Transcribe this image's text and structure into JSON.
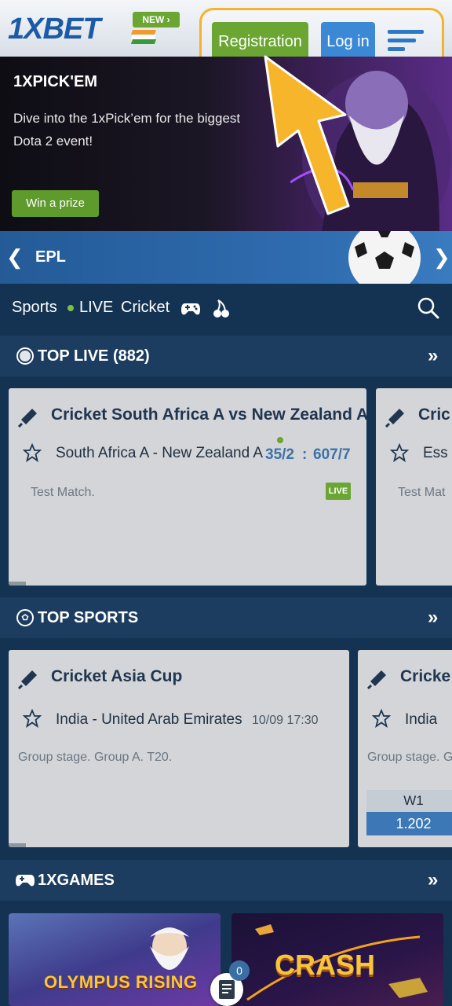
{
  "header": {
    "logo": "1XBET",
    "new_badge": "NEW",
    "register_label": "Registration",
    "login_label": "Log in"
  },
  "promo": {
    "title": "1XPICK'EM",
    "text": "Dive into the 1xPick’em for the biggest Dota 2 event!",
    "button": "Win a prize"
  },
  "carousel": {
    "label": "EPL"
  },
  "nav": {
    "sports": "Sports",
    "live": "LIVE",
    "cricket": "Cricket"
  },
  "top_live": {
    "title": "TOP LIVE (882)",
    "card": {
      "sport": "Cricket South Africa A vs New Zealand A",
      "teams": "South Africa A - New Zealand A",
      "score1": "35/2",
      "score_sep": ":",
      "score2": "607/7",
      "meta": "Test Match.",
      "live_badge": "LIVE"
    },
    "card2": {
      "sport": "Cric",
      "teams": "Ess",
      "meta": "Test Mat"
    }
  },
  "top_sports": {
    "title": "TOP SPORTS",
    "card": {
      "sport": "Cricket Asia Cup",
      "teams": "India - United Arab Emirates",
      "date": "10/09 17:30",
      "meta": "Group stage. Group A. T20."
    },
    "card2": {
      "sport": "Cricke",
      "teams": "India",
      "meta": "Group stage. G",
      "odds_head": "W1",
      "odds_val": "1.202"
    }
  },
  "games": {
    "title": "1XGAMES",
    "tile1": "OLYMPUS RISING",
    "tile2": "CRASH"
  },
  "betslip": {
    "count": "0"
  },
  "colors": {
    "green": "#6aa631",
    "blue": "#3b89d4",
    "highlight": "#f5b22b",
    "navy": "#143353"
  }
}
